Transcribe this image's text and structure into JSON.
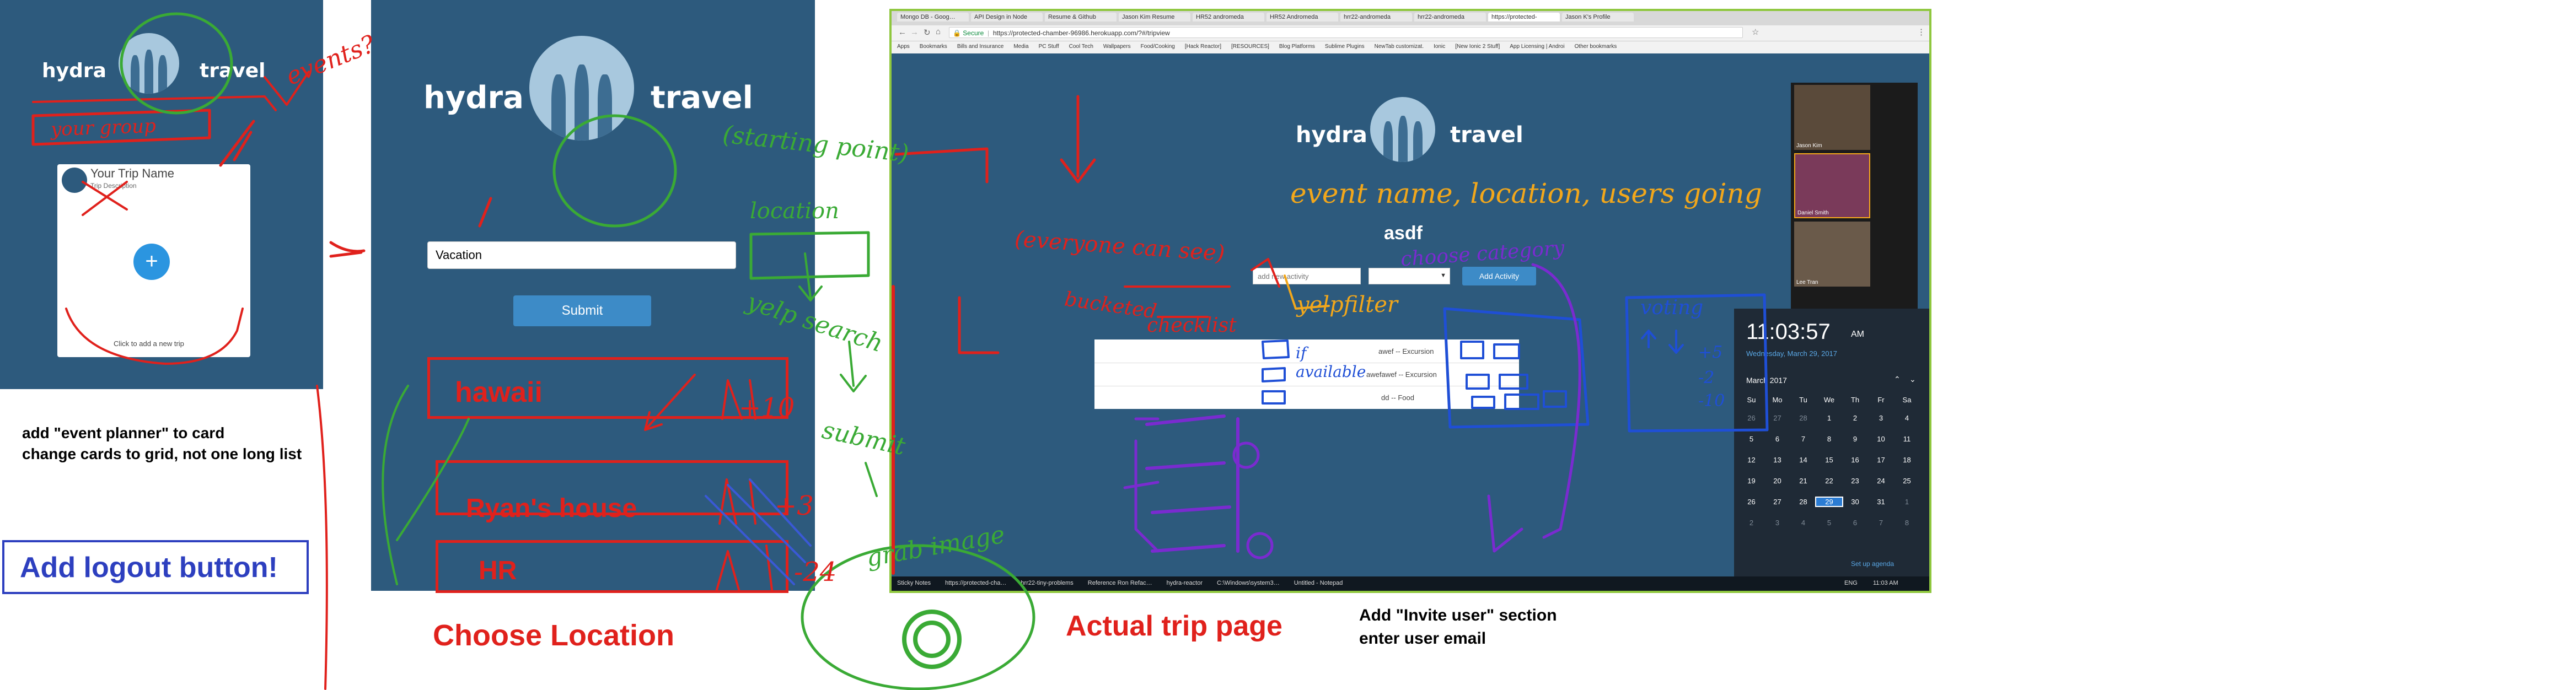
{
  "brand": {
    "left": "hydra",
    "right": "travel"
  },
  "panel1": {
    "trip_name": "Your Trip Name",
    "trip_desc": "Trip Description",
    "add_label": "+",
    "add_hint": "Click to add a new trip"
  },
  "panel2": {
    "input_value": "Vacation",
    "submit_label": "Submit",
    "locations": [
      "hawaii",
      "Ryan's house",
      "HR"
    ],
    "caption": "Choose Location"
  },
  "notes": {
    "note1": "add \"event planner\" to card",
    "note2": "change cards to grid, not one long list",
    "logout": "Add logout button!",
    "invite1": "Add \"Invite user\" section",
    "invite2": "enter user email"
  },
  "panel3": {
    "caption": "Actual trip page",
    "trip_title": "asdf",
    "activity_placeholder": "add new activity",
    "add_activity": "Add Activity",
    "activities": [
      "awef -- Excursion",
      "awefawef -- Excursion",
      "dd -- Food"
    ],
    "browser": {
      "tabs": [
        "Mongo DB - Goog…",
        "API Design in Node",
        "Resume & Github",
        "Jason Kim Resume",
        "HR52 andromeda",
        "HR52 Andromeda",
        "hrr22-andromeda",
        "hrr22-andromeda",
        "https://protected-",
        "Jason K's Profile"
      ],
      "url": "https://protected-chamber-96986.herokuapp.com/?#/tripview",
      "secure_label": "Secure",
      "bookmarks": [
        "Apps",
        "Bookmarks",
        "Bills and Insurance",
        "Media",
        "PC Stuff",
        "Cool Tech",
        "Wallpapers",
        "Food/Cooking",
        "[Hack Reactor]",
        "[RESOURCES]",
        "Blog Platforms",
        "Sublime Plugins",
        "NewTab customizat.",
        "Ionic",
        "[New Ionic 2 Stuff]",
        "App Licensing | Androi",
        "Other bookmarks"
      ]
    },
    "taskbar": [
      "Sticky Notes",
      "https://protected-cha…",
      "hrr22-tiny-problems",
      "Reference Ron Refac…",
      "hydra-reactor",
      "C:\\Windows\\system3…",
      "Untitled - Notepad"
    ],
    "tray_lang": "ENG",
    "tray_time": "11:03 AM",
    "video_names": [
      "Jason Kim",
      "Daniel Smith",
      "Lee Tran"
    ],
    "clock": {
      "time": "11:03:57",
      "ampm": "AM",
      "date": "Wednesday, March 29, 2017",
      "month": "March 2017",
      "weekdays": [
        "Su",
        "Mo",
        "Tu",
        "We",
        "Th",
        "Fr",
        "Sa"
      ],
      "weeks": [
        [
          "26",
          "27",
          "28",
          "1",
          "2",
          "3",
          "4"
        ],
        [
          "5",
          "6",
          "7",
          "8",
          "9",
          "10",
          "11"
        ],
        [
          "12",
          "13",
          "14",
          "15",
          "16",
          "17",
          "18"
        ],
        [
          "19",
          "20",
          "21",
          "22",
          "23",
          "24",
          "25"
        ],
        [
          "26",
          "27",
          "28",
          "29",
          "30",
          "31",
          "1"
        ],
        [
          "2",
          "3",
          "4",
          "5",
          "6",
          "7",
          "8"
        ]
      ],
      "today": "29",
      "agenda": "Set up agenda"
    }
  },
  "annotations": {
    "events": "events?",
    "your_group": "your group",
    "starting_point": "(starting point)",
    "location": "location",
    "yelp_search": "yelp search",
    "submit": "submit",
    "grab_image": "grab image",
    "everyone_can_see": "(everyone can see)",
    "bucketed": "bucketed",
    "checklist": "checklist",
    "event_name": "event name, location, users going",
    "choose_category": "choose category",
    "yelp_filter": "yelpfilter",
    "if_available": "if available",
    "voting": "voting",
    "counts": [
      "+10",
      "+3",
      "-24"
    ],
    "vote_rows": [
      "+5",
      "-2",
      "-10"
    ]
  },
  "colors": {
    "panel_bg": "#2d5a7d",
    "red_ink": "#e0211c",
    "green_ink": "#3aaa35",
    "orange_ink": "#f2a71b",
    "purple_ink": "#7a2bd0",
    "blue_ink": "#1f4fd6",
    "accent_button": "#3d8bc7"
  }
}
